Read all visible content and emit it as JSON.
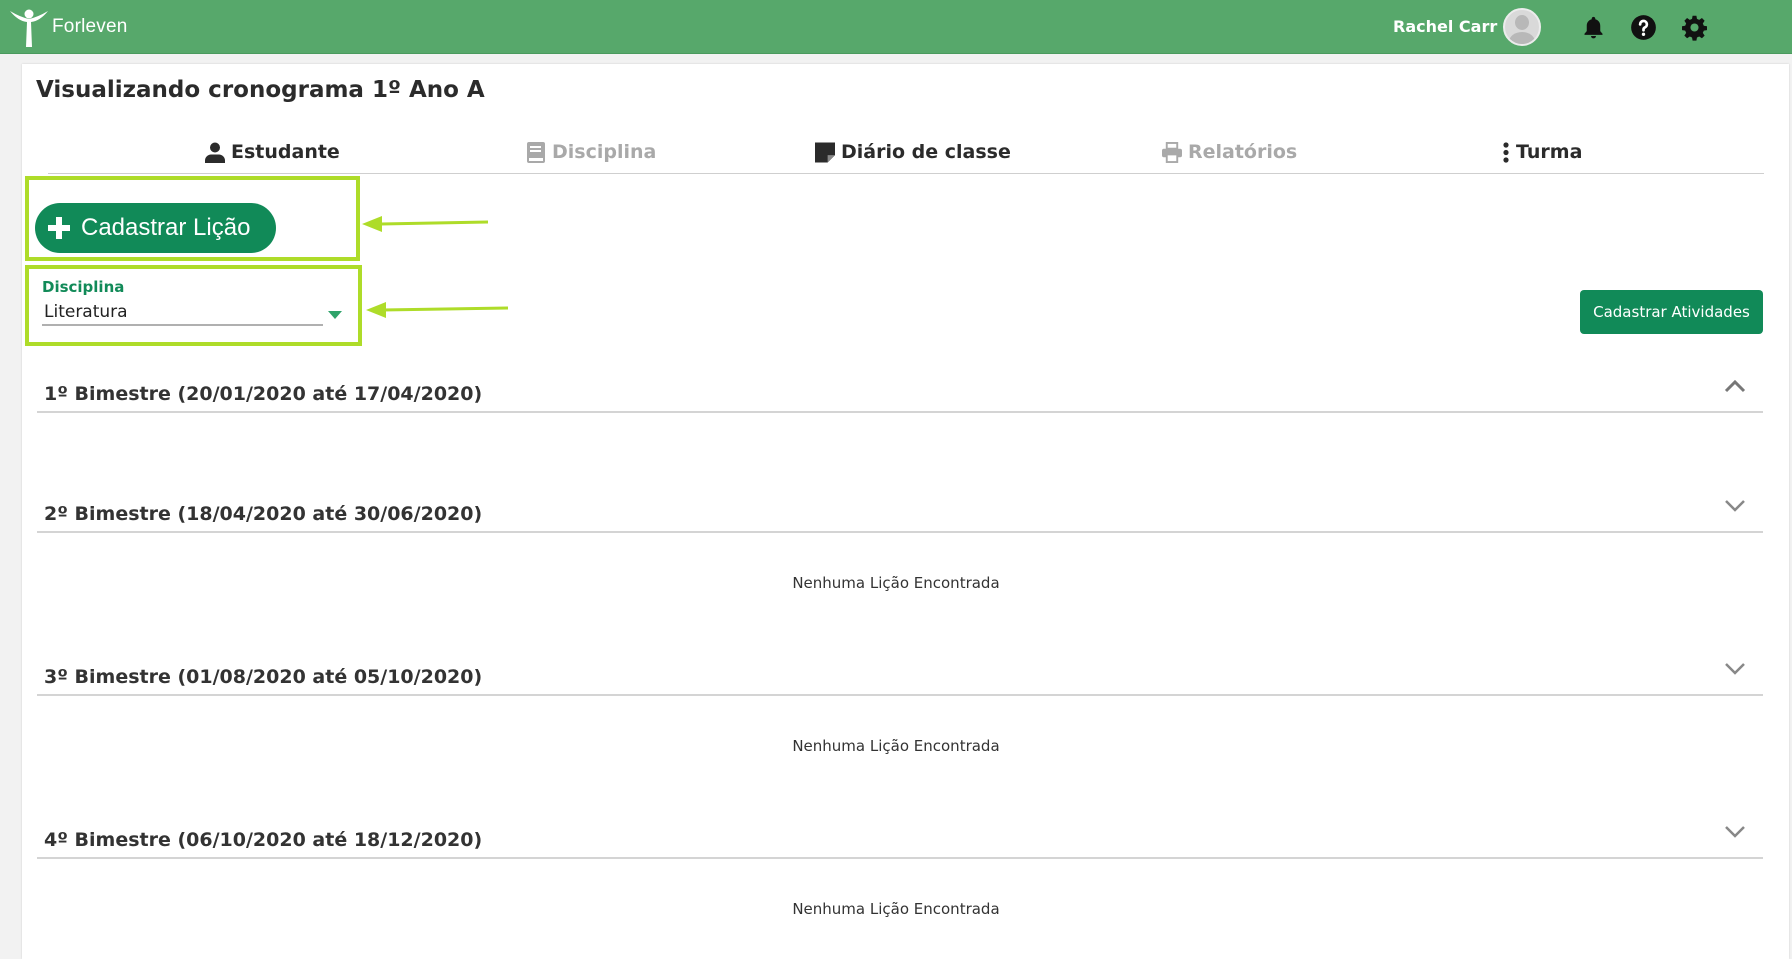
{
  "header": {
    "logo_text": "Forleven",
    "user_name": "Rachel Carr",
    "icons": [
      "bell-icon",
      "help-icon",
      "gear-icon"
    ],
    "bar_color": "#57a86b"
  },
  "page": {
    "title": "Visualizando cronograma 1º Ano A"
  },
  "tabs": [
    {
      "label": "Estudante",
      "icon": "user-icon",
      "enabled": true
    },
    {
      "label": "Disciplina",
      "icon": "book-icon",
      "enabled": false
    },
    {
      "label": "Diário de classe",
      "icon": "note-icon",
      "enabled": true
    },
    {
      "label": "Relatórios",
      "icon": "printer-icon",
      "enabled": false
    },
    {
      "label": "Turma",
      "icon": "more-vertical-icon",
      "enabled": true
    }
  ],
  "actions": {
    "add_lesson_label": "Cadastrar Lição",
    "add_activities_label": "Cadastrar Atividades",
    "primary_color": "#118a58",
    "highlight_color": "#aedc29"
  },
  "discipline_select": {
    "label": "Disciplina",
    "value": "Literatura"
  },
  "bimesters": [
    {
      "title": "1º Bimestre (20/01/2020 até 17/04/2020)",
      "expanded": true,
      "empty_text": ""
    },
    {
      "title": "2º Bimestre (18/04/2020 até 30/06/2020)",
      "expanded": false,
      "empty_text": "Nenhuma Lição Encontrada"
    },
    {
      "title": "3º Bimestre (01/08/2020 até 05/10/2020)",
      "expanded": false,
      "empty_text": "Nenhuma Lição Encontrada"
    },
    {
      "title": "4º Bimestre (06/10/2020 até 18/12/2020)",
      "expanded": false,
      "empty_text": "Nenhuma Lição Encontrada"
    }
  ]
}
